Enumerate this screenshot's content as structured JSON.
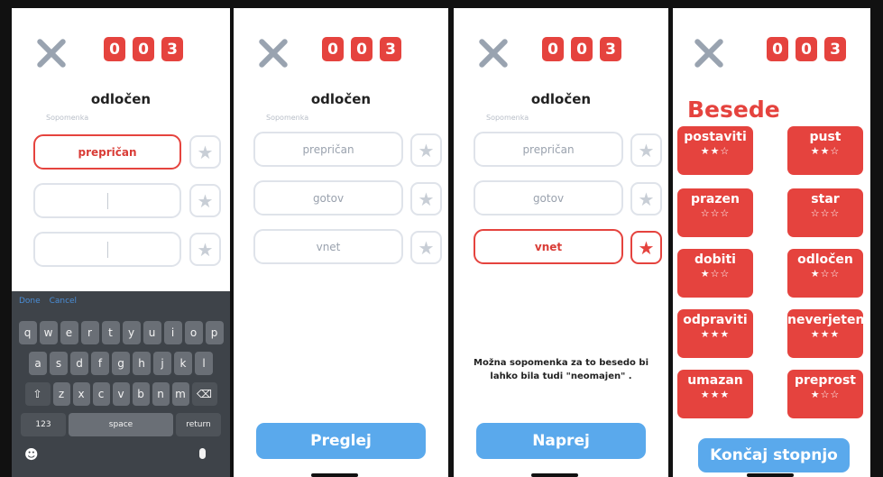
{
  "score_digits": [
    "0",
    "0",
    "3"
  ],
  "quiz": {
    "word": "odločen",
    "sublabel": "Sopomenka"
  },
  "panel1": {
    "answers": [
      "prepričan",
      "",
      ""
    ],
    "keyboard": {
      "done": "Done",
      "cancel": "Cancel",
      "row1": [
        "q",
        "w",
        "e",
        "r",
        "t",
        "y",
        "u",
        "i",
        "o",
        "p"
      ],
      "row2": [
        "a",
        "s",
        "d",
        "f",
        "g",
        "h",
        "j",
        "k",
        "l"
      ],
      "row3": [
        "z",
        "x",
        "c",
        "v",
        "b",
        "n",
        "m"
      ],
      "numbers": "123",
      "space": "space",
      "return": "return"
    }
  },
  "panel2": {
    "answers": [
      "prepričan",
      "gotov",
      "vnet"
    ],
    "button": "Preglej"
  },
  "panel3": {
    "answers": [
      "prepričan",
      "gotov",
      "vnet"
    ],
    "hint": "Možna sopomenka za to besedo bi lahko bila tudi \"neomajen\" .",
    "button": "Naprej"
  },
  "panel4": {
    "title": "Besede",
    "words": [
      {
        "word": "postaviti",
        "stars": "★★☆"
      },
      {
        "word": "pust",
        "stars": "★★☆"
      },
      {
        "word": "prazen",
        "stars": "☆☆☆"
      },
      {
        "word": "star",
        "stars": "☆☆☆"
      },
      {
        "word": "dobiti",
        "stars": "★☆☆"
      },
      {
        "word": "odločen",
        "stars": "★☆☆"
      },
      {
        "word": "odpraviti",
        "stars": "★★★"
      },
      {
        "word": "neverjeten",
        "stars": "★★★"
      },
      {
        "word": "umazan",
        "stars": "★★★"
      },
      {
        "word": "preprost",
        "stars": "★☆☆"
      }
    ],
    "button": "Končaj stopnjo"
  },
  "icons": {
    "close": "close-icon",
    "star": "star-icon",
    "emoji": "emoji-icon",
    "mic": "microphone-icon",
    "shift": "shift-icon",
    "backspace": "backspace-icon"
  },
  "colors": {
    "accent": "#e5433e",
    "button": "#5aa9ec",
    "border": "#dfe3ea"
  }
}
